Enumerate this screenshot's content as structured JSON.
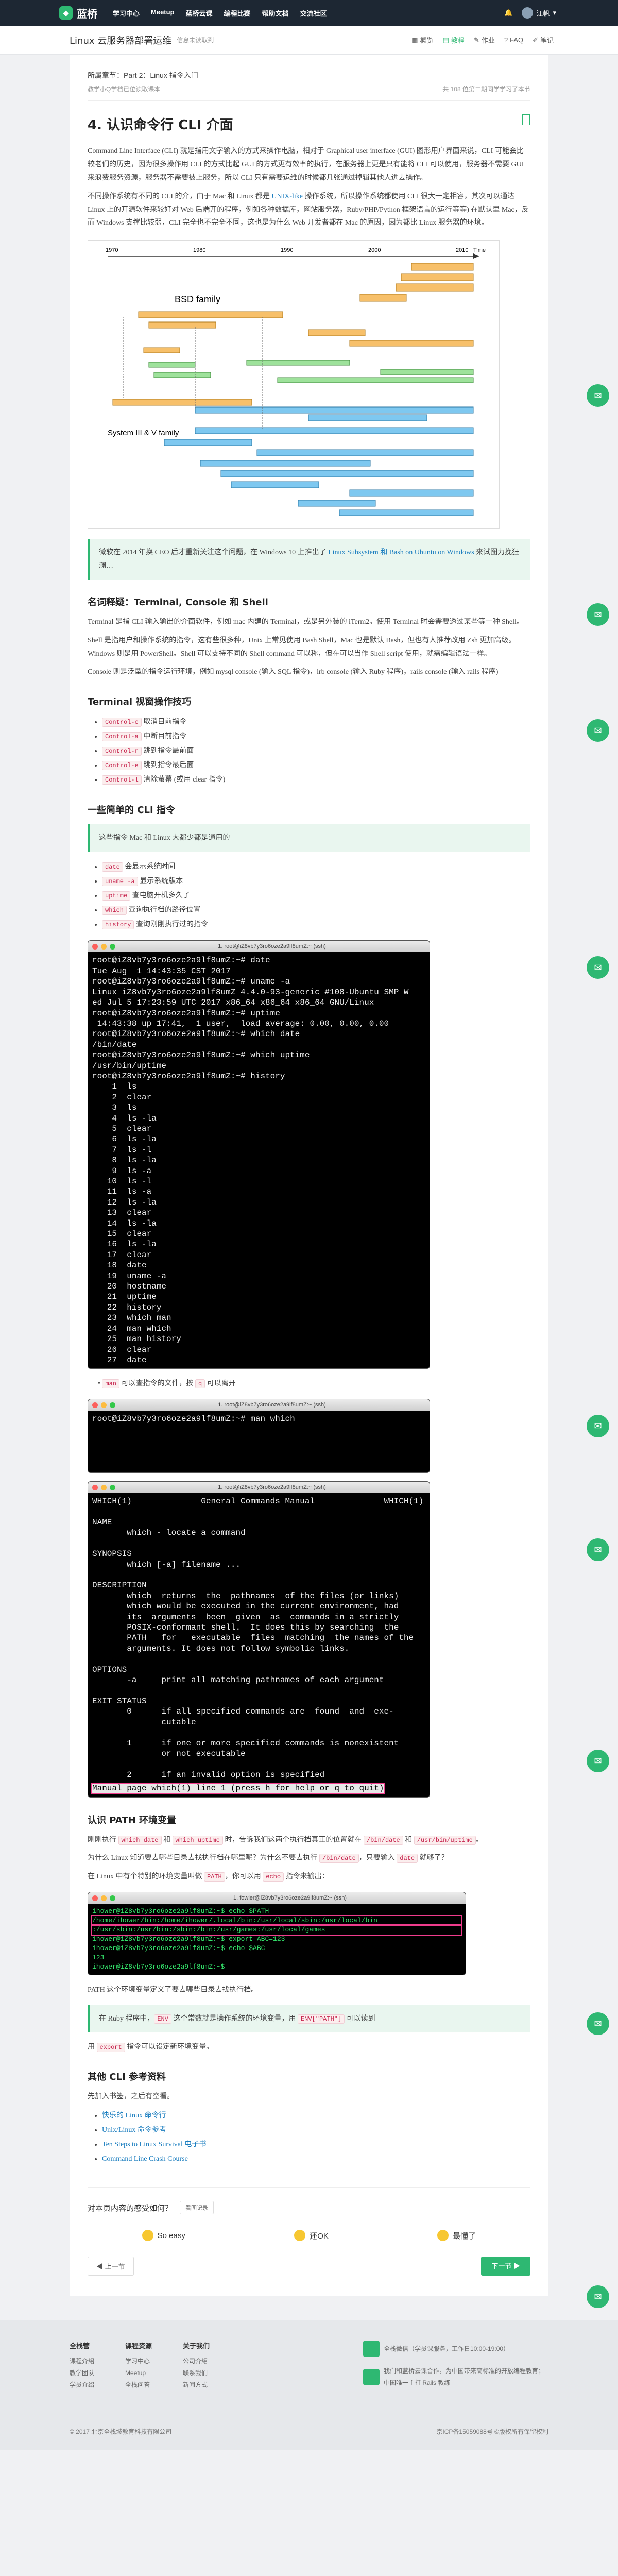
{
  "topbar": {
    "logo": "蓝桥",
    "nav": [
      "学习中心",
      "Meetup",
      "蓝桥云课",
      "编程比赛",
      "帮助文档",
      "交流社区"
    ],
    "user": "江帆"
  },
  "course": {
    "title": "Linux 云服务器部署运维",
    "subtitle": "信息未读取到",
    "tabs": [
      "概览",
      "教程",
      "作业",
      "FAQ",
      "笔记"
    ]
  },
  "section": {
    "breadcrumb": "所属章节：Part 2：Linux 指令入门",
    "hint": "教学小Q学档已位读取课本",
    "stats": "共 108 位第二期同学学习了本节"
  },
  "lab": {
    "title": "4. 认识命令行 CLI 介面",
    "p1": "Command Line Interface (CLI) 就是指用文字输入的方式来操作电脑，相对于 Graphical user interface (GUI) 图形用户界面来说，CLI 可能会比较老们的历史，因为很多操作用 CLI 的方式比起 GUI 的方式更有效率的执行，在服务器上更是只有能将 CLI 可以使用，服务器不需要 GUI 来浪费服务资源，服务器不需要被上服务，所以 CLI 只有需要运维的时候都几张通过掉辑其他人进去操作。",
    "p2_a": "不同操作系统有不同的 CLI 的介，由于 Mac 和 Linux 都是 ",
    "p2_link": "UNIX-like",
    "p2_b": " 操作系统，所以操作系统都使用 CLI 很大一定相容，其次可以通达 Linux 上的开源软件来较好对 Web 后端开的程序，例如各种数据库，网站服务器，Ruby/PHP/Python 框架语言的运行等等) 在默认里 Mac，反而 Windows 支撑比较弱，CLI 完全也不完全不同，这也是为什么 Web 开发者都在 Mac 的原因，因为都比 Linux 服务器的环境。",
    "figure": {
      "label": "BSD family",
      "label2": "System III & V family",
      "years": [
        "1970",
        "1980",
        "1990",
        "2000",
        "2010"
      ],
      "time": "Time"
    },
    "note1_a": "微软在 2014 年换 CEO 后才重新关注这个问题，在 Windows 10 上推出了 ",
    "note1_link": "Linux Subsystem 和 Bash on Ubuntu on Windows",
    "note1_b": " 来试图力挽狂澜…",
    "h_term": "名词释疑：Terminal, Console 和 Shell",
    "p3": "Terminal 是指 CLI 输入输出的介面软件，例如 mac 内建的 Terminal，或是另外装的 iTerm2。使用 Terminal 时会需要透过某些等一种 Shell。",
    "p4": "Shell 是指用户和操作系统的指令，这有些很多种，Unix 上常见使用 Bash Shell，Mac 也是默认 Bash，但也有人推荐改用 Zsh 更加高级。Windows 则是用 PowerShell。Shell 可以支持不同的 Shell command 可以称，但在可以当作 Shell script 使用，就需编辑语法一样。",
    "p5": "Console 则是泛型的指令运行环境，例如 mysql console (输入 SQL 指令)，irb console (输入 Ruby 程序)，rails console (输入 rails 程序)",
    "h_tips": "Terminal 视窗操作技巧",
    "tips": [
      [
        "Control-c",
        "取消目前指令"
      ],
      [
        "Control-a",
        "中断目前指令"
      ],
      [
        "Control-r",
        "跳到指令最前面"
      ],
      [
        "Control-e",
        "跳到指令最后面"
      ],
      [
        "Control-l",
        "清除萤幕 (或用 clear 指令)"
      ]
    ],
    "h_cmds": "一些简单的 CLI 指令",
    "note2": "这些指令 Mac 和 Linux 大都少都是通用的",
    "cmds": [
      [
        "date",
        "会显示系统时间"
      ],
      [
        "uname -a",
        "显示系统版本"
      ],
      [
        "uptime",
        "查电脑开机多久了"
      ],
      [
        "which",
        "查询执行档的路径位置"
      ],
      [
        "history",
        "查询刚刚执行过的指令"
      ]
    ],
    "term1": {
      "title": "1. root@iZ8vb7y3ro6oze2a9lf8umZ:~ (ssh)",
      "lines": [
        "root@iZ8vb7y3ro6oze2a9lf8umZ:~# date",
        "Tue Aug  1 14:43:35 CST 2017",
        "root@iZ8vb7y3ro6oze2a9lf8umZ:~# uname -a",
        "Linux iZ8vb7y3ro6oze2a9lf8umZ 4.4.0-93-generic #108-Ubuntu SMP W",
        "ed Jul 5 17:23:59 UTC 2017 x86_64 x86_64 x86_64 GNU/Linux",
        "root@iZ8vb7y3ro6oze2a9lf8umZ:~# uptime",
        " 14:43:38 up 17:41,  1 user,  load average: 0.00, 0.00, 0.00",
        "root@iZ8vb7y3ro6oze2a9lf8umZ:~# which date",
        "/bin/date",
        "root@iZ8vb7y3ro6oze2a9lf8umZ:~# which uptime",
        "/usr/bin/uptime",
        "root@iZ8vb7y3ro6oze2a9lf8umZ:~# history",
        "    1  ls",
        "    2  clear",
        "    3  ls",
        "    4  ls -la",
        "    5  clear",
        "    6  ls -la",
        "    7  ls -l",
        "    8  ls -la",
        "    9  ls -a",
        "   10  ls -l",
        "   11  ls -a",
        "   12  ls -la",
        "   13  clear",
        "   14  ls -la",
        "   15  clear",
        "   16  ls -la",
        "   17  clear",
        "   18  date",
        "   19  uname -a",
        "   20  hostname",
        "   21  uptime",
        "   22  history",
        "   23  which man",
        "   24  man which",
        "   25  man history",
        "   26  clear",
        "   27  date"
      ]
    },
    "man_hint_pre": "",
    "man_hint_code1": "man",
    "man_hint_mid": " 可以查指令的文件，按 ",
    "man_hint_code2": "q",
    "man_hint_post": " 可以离开",
    "term2": {
      "title": "1. root@iZ8vb7y3ro6oze2a9lf8umZ:~ (ssh)",
      "line": "root@iZ8vb7y3ro6oze2a9lf8umZ:~# man which"
    },
    "term3": {
      "title": "1. root@iZ8vb7y3ro6oze2a9lf8umZ:~ (ssh)",
      "lines": [
        "WHICH(1)              General Commands Manual              WHICH(1)",
        "",
        "NAME",
        "       which - locate a command",
        "",
        "SYNOPSIS",
        "       which [-a] filename ...",
        "",
        "DESCRIPTION",
        "       which  returns  the  pathnames  of the files (or links)",
        "       which would be executed in the current environment, had",
        "       its  arguments  been  given  as  commands in a strictly",
        "       POSIX-conformant shell.  It does this by searching  the",
        "       PATH   for   executable  files  matching  the names of the",
        "       arguments. It does not follow symbolic links.",
        "",
        "OPTIONS",
        "       -a     print all matching pathnames of each argument",
        "",
        "EXIT STATUS",
        "       0      if all specified commands are  found  and  exe-",
        "              cutable",
        "",
        "       1      if one or more specified commands is nonexistent",
        "              or not executable",
        "",
        "       2      if an invalid option is specified"
      ],
      "status": "Manual page which(1) line 1 (press h for help or q to quit)"
    },
    "h_path": "认识 PATH 环境变量",
    "p_path1_a": "刚刚执行 ",
    "p_path1_c1": "which date",
    "p_path1_b": " 和 ",
    "p_path1_c2": "which uptime",
    "p_path1_c": " 时，告诉我们这两个执行档真正的位置就在 ",
    "p_path1_c3": "/bin/date",
    "p_path1_d": " 和 ",
    "p_path1_c4": "/usr/bin/uptime",
    "p_path1_e": "。",
    "p_path2_a": "为什么 Linux 知道要去哪些目录去找执行档在哪里呢？为什么不要去执行 ",
    "p_path2_c1": "/bin/date",
    "p_path2_b": "，只要输入 ",
    "p_path2_c2": "date",
    "p_path2_c": " 就够了？",
    "p_path3_a": "在 Linux 中有个特别的环境变量叫做 ",
    "p_path3_c1": "PATH",
    "p_path3_b": "，你可以用 ",
    "p_path3_c2": "echo",
    "p_path3_c": " 指令来输出：",
    "term4": {
      "title": "1. fowler@iZ8vb7y3ro6oze2a9lf8umZ:~ (ssh)",
      "lines": [
        "ihower@iZ8vb7y3ro6oze2a9lf8umZ:~$ echo $PATH",
        "/home/ihower/bin:/home/ihower/.local/bin:/usr/local/sbin:/usr/local/bin",
        ":/usr/sbin:/usr/bin:/sbin:/bin:/usr/games:/usr/local/games",
        "ihower@iZ8vb7y3ro6oze2a9lf8umZ:~$ export ABC=123",
        "ihower@iZ8vb7y3ro6oze2a9lf8umZ:~$ echo $ABC",
        "123",
        "ihower@iZ8vb7y3ro6oze2a9lf8umZ:~$ "
      ]
    },
    "p_path4": "PATH 这个环境变量定义了要去哪些目录去找执行档。",
    "note3_a": "在 Ruby 程序中，",
    "note3_c1": "ENV",
    "note3_b": " 这个常数就是操作系统的环境变量，用 ",
    "note3_c2": "ENV[\"PATH\"]",
    "note3_c": " 可以读到",
    "p_export_a": "用 ",
    "p_export_c": "export",
    "p_export_b": " 指令可以设定新环境变量。",
    "h_ref": "其他 CLI 参考资料",
    "ref_intro": "先加入书签，之后有空看。",
    "refs": [
      "快乐的 Linux 命令行",
      "Unix/Linux 命令参考",
      "Ten Steps to Linux Survival 电子书",
      "Command Line Crash Course"
    ]
  },
  "feedback": {
    "question": "对本页内容的感受如何？",
    "btn": "看图记录",
    "options": [
      "So easy",
      "还OK",
      "最懂了"
    ]
  },
  "pager": {
    "prev": "◀ 上一节",
    "next": "下一节 ▶"
  },
  "footer": {
    "cols": [
      {
        "title": "全栈营",
        "items": [
          "课程介绍",
          "教学团队",
          "学员介绍"
        ]
      },
      {
        "title": "课程资源",
        "items": [
          "学习中心",
          "Meetup",
          "全栈问答"
        ]
      },
      {
        "title": "关于我们",
        "items": [
          "公司介绍",
          "联系我们",
          "新闻方式"
        ]
      }
    ],
    "contact": "全栈微信（学员课服务，工作日10:00-19:00）",
    "partner": "我们和蓝桥云课合作，为中国带来高标准的开放编程教育；中国唯一主打 Rails 教练",
    "copyright": "© 2017 北京全栈城教育科技有限公司",
    "icp": "京ICP备15059088号 ©版权所有保留权利"
  }
}
